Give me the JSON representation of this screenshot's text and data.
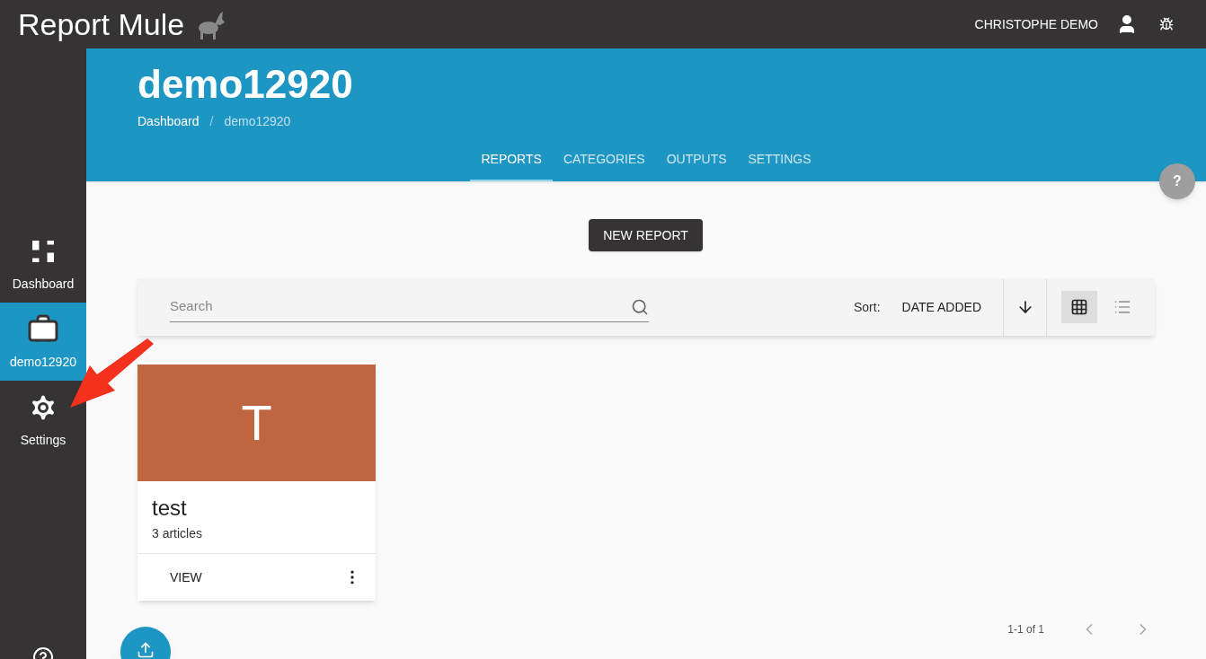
{
  "app": {
    "title_light": "Report",
    "title_bold": "Mule",
    "user": "CHRISTOPHE DEMO"
  },
  "sidebar": {
    "items": [
      {
        "label": "Dashboard",
        "kind": "dashboard",
        "selected": false
      },
      {
        "label": "demo12920",
        "kind": "briefcase",
        "selected": true
      },
      {
        "label": "Settings",
        "kind": "settings",
        "selected": false
      }
    ]
  },
  "header": {
    "title": "demo12920",
    "breadcrumb": [
      "Dashboard",
      "demo12920"
    ],
    "breadcrumb_separator": "/",
    "tabs": [
      {
        "label": "REPORTS",
        "selected": true
      },
      {
        "label": "CATEGORIES",
        "selected": false
      },
      {
        "label": "OUTPUTS",
        "selected": false
      },
      {
        "label": "SETTINGS",
        "selected": false
      }
    ],
    "help": "?"
  },
  "new_report_button": "NEW REPORT",
  "toolbar": {
    "search_placeholder": "Search",
    "sort_label": "Sort:",
    "sort_value": "DATE ADDED",
    "views": [
      {
        "kind": "grid",
        "selected": true
      },
      {
        "kind": "list",
        "selected": false
      }
    ]
  },
  "reports": [
    {
      "initial": "T",
      "color": "#bf6640",
      "name": "test",
      "count": "3 articles",
      "action": "VIEW"
    }
  ],
  "pagination": {
    "range": "1-1 of 1"
  }
}
